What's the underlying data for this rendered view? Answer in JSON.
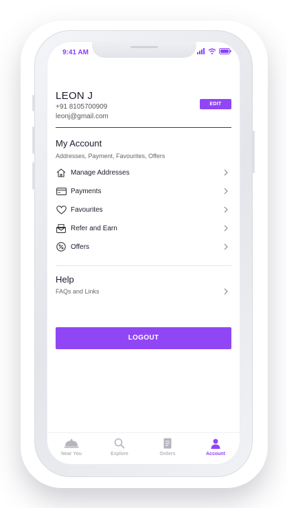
{
  "status_bar": {
    "time": "9:41 AM"
  },
  "profile": {
    "name": "LEON J",
    "phone": "+91 8105700909",
    "email": "leonj@gmail.com",
    "edit_label": "EDIT"
  },
  "account": {
    "title": "My Account",
    "subtitle": "Addresses, Payment, Favourites, Offers",
    "items": [
      {
        "label": "Manage Addresses",
        "icon": "home-icon"
      },
      {
        "label": "Payments",
        "icon": "card-icon"
      },
      {
        "label": "Favourites",
        "icon": "heart-icon"
      },
      {
        "label": "Refer and Earn",
        "icon": "envelope-icon"
      },
      {
        "label": "Offers",
        "icon": "percent-icon"
      }
    ]
  },
  "help": {
    "title": "Help",
    "subtitle": "FAQs and Links"
  },
  "logout_label": "LOGOUT",
  "bottom_nav": [
    {
      "label": "Near You",
      "icon": "cloche-icon",
      "active": false
    },
    {
      "label": "Explore",
      "icon": "search-icon",
      "active": false
    },
    {
      "label": "Orders",
      "icon": "receipt-icon",
      "active": false
    },
    {
      "label": "Account",
      "icon": "user-icon",
      "active": true
    }
  ],
  "colors": {
    "accent": "#9146f5",
    "text": "#1a1a2e",
    "inactive": "#b5b5bd"
  }
}
